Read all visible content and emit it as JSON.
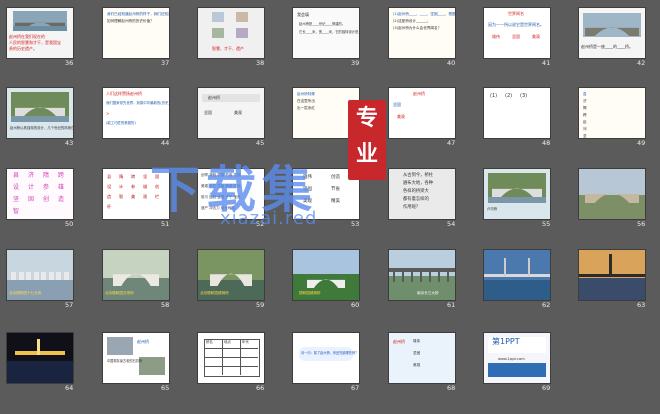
{
  "slides": [
    {
      "num": "36",
      "lines": [
        "赵州桥在我们现在的",
        "人民的智慧和才干，是我国宝",
        "贵的历史遗产。"
      ]
    },
    {
      "num": "37",
      "lines": [
        "我们已经知道赵州桥的样子，我们还知道赵州桥有什么特点吗？",
        "如何理解赵州桥的历史价值？"
      ]
    },
    {
      "num": "38",
      "lines": [
        "智慧、才干、遗产"
      ]
    },
    {
      "num": "39",
      "lines": [
        "我会填",
        "赵州桥是____世纪____修建的。",
        "它长____米，宽____米，它的独特设计是____。"
      ]
    },
    {
      "num": "40",
      "lines": [
        "(1)赵州桥____、____、坚固____，根据____设计的。",
        "(2)这座桥设计______。",
        "(3)赵州桥为什么会世界闻名？"
      ]
    },
    {
      "num": "41",
      "lines": [
        "世界闻名",
        "因为——所以说它是世界闻名。",
        "雄伟",
        "坚固",
        "美观"
      ]
    },
    {
      "num": "42",
      "lines": [
        "赵州桥是一座____的____桥。"
      ]
    },
    {
      "num": "43",
      "lines": [
        "赵州桥以其独特的设计，几个世纪的风雨它依然屹立。"
      ]
    },
    {
      "num": "44",
      "lines": [
        "人们这样赞扬赵州桥",
        "我们国家领先世界，到乘中华最新的(历史)",
        ">",
        "(能工巧匠的美丽的)"
      ]
    },
    {
      "num": "45",
      "lines": [
        "赵州桥",
        "坚固",
        "美观"
      ]
    },
    {
      "num": "46",
      "lines": [
        "赵州桥特殊",
        "在这里所出",
        "出一层赤红"
      ]
    },
    {
      "num": "47",
      "lines": [
        "赵州桥",
        "坚固",
        "美观"
      ]
    },
    {
      "num": "48",
      "lines": [
        "(1)",
        "(2)",
        "(3)"
      ]
    },
    {
      "num": "49",
      "lines": [
        "县",
        "济",
        "隋",
        "跨",
        "赵",
        "河",
        "坚",
        "爪"
      ]
    },
    {
      "num": "50",
      "lines": [
        "县",
        "济",
        "隋",
        "跨",
        "设",
        "计",
        "参",
        "雄",
        "坚",
        "固",
        "创",
        "造",
        "智"
      ]
    },
    {
      "num": "51",
      "lines": [
        "县",
        "隋",
        "跨",
        "坚",
        "固",
        "设",
        "计",
        "参",
        "雄",
        "创",
        "造",
        "智",
        "美",
        "观",
        "栏",
        "杆"
      ]
    },
    {
      "num": "52",
      "lines": [
        "创举 减轻 重量 节省 坚固",
        "美观 石栏 栏板 精美 图案",
        "前爪 回首 遥望 才干 宝贵",
        "遗产 冲击力 双龙戏珠"
      ]
    },
    {
      "num": "53",
      "lines": [
        "雄伟",
        "创造",
        "坚固",
        "节省",
        "美观",
        "精美"
      ]
    },
    {
      "num": "54",
      "lines": [
        "从古到今，桥柱",
        "遍布大地，各种",
        "各样的桥梁大",
        "都有着怎样的",
        "作用呢？"
      ]
    },
    {
      "num": "55",
      "lines": [
        "卢沟桥"
      ]
    },
    {
      "num": "56",
      "lines": []
    },
    {
      "num": "57",
      "lines": [
        "北京颐和园十七孔桥"
      ]
    },
    {
      "num": "58",
      "lines": [
        "北京颐和园玉带桥"
      ]
    },
    {
      "num": "59",
      "lines": [
        "北京颐和园绣漪桥"
      ]
    },
    {
      "num": "60",
      "lines": [
        "颐和园绣漪桥"
      ]
    },
    {
      "num": "61",
      "lines": [
        "南京长江大桥"
      ]
    },
    {
      "num": "62",
      "lines": []
    },
    {
      "num": "63",
      "lines": []
    },
    {
      "num": "64",
      "lines": []
    },
    {
      "num": "65",
      "lines": [
        "赵州桥",
        "中国现存最古老的石拱桥"
      ]
    },
    {
      "num": "66",
      "lines": [
        "桥名",
        "地点",
        "年代",
        "特点"
      ]
    },
    {
      "num": "67",
      "lines": [
        "问一问：除了赵州桥，你还知道哪些桥？"
      ]
    },
    {
      "num": "68",
      "lines": [
        "赵州桥",
        "雄伟",
        "坚固",
        "美观"
      ]
    },
    {
      "num": "69",
      "lines": [
        "第1PPT",
        "www.1ppt.com"
      ]
    }
  ],
  "watermark": {
    "title": "下载集",
    "seal": "专业",
    "url": "xiazai.red"
  },
  "colors": {
    "background": "#5b5b5b",
    "accent_red": "#d21d1d",
    "accent_blue": "#1f5bb3",
    "watermark_blue": "#5a8ceb",
    "seal": "#c8282b"
  }
}
